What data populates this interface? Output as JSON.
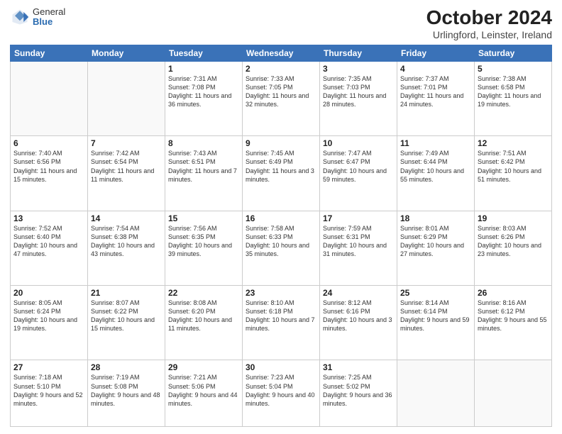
{
  "logo": {
    "general": "General",
    "blue": "Blue"
  },
  "header": {
    "title": "October 2024",
    "subtitle": "Urlingford, Leinster, Ireland"
  },
  "days_of_week": [
    "Sunday",
    "Monday",
    "Tuesday",
    "Wednesday",
    "Thursday",
    "Friday",
    "Saturday"
  ],
  "weeks": [
    [
      {
        "day": "",
        "detail": ""
      },
      {
        "day": "",
        "detail": ""
      },
      {
        "day": "1",
        "detail": "Sunrise: 7:31 AM\nSunset: 7:08 PM\nDaylight: 11 hours\nand 36 minutes."
      },
      {
        "day": "2",
        "detail": "Sunrise: 7:33 AM\nSunset: 7:05 PM\nDaylight: 11 hours\nand 32 minutes."
      },
      {
        "day": "3",
        "detail": "Sunrise: 7:35 AM\nSunset: 7:03 PM\nDaylight: 11 hours\nand 28 minutes."
      },
      {
        "day": "4",
        "detail": "Sunrise: 7:37 AM\nSunset: 7:01 PM\nDaylight: 11 hours\nand 24 minutes."
      },
      {
        "day": "5",
        "detail": "Sunrise: 7:38 AM\nSunset: 6:58 PM\nDaylight: 11 hours\nand 19 minutes."
      }
    ],
    [
      {
        "day": "6",
        "detail": "Sunrise: 7:40 AM\nSunset: 6:56 PM\nDaylight: 11 hours\nand 15 minutes."
      },
      {
        "day": "7",
        "detail": "Sunrise: 7:42 AM\nSunset: 6:54 PM\nDaylight: 11 hours\nand 11 minutes."
      },
      {
        "day": "8",
        "detail": "Sunrise: 7:43 AM\nSunset: 6:51 PM\nDaylight: 11 hours\nand 7 minutes."
      },
      {
        "day": "9",
        "detail": "Sunrise: 7:45 AM\nSunset: 6:49 PM\nDaylight: 11 hours\nand 3 minutes."
      },
      {
        "day": "10",
        "detail": "Sunrise: 7:47 AM\nSunset: 6:47 PM\nDaylight: 10 hours\nand 59 minutes."
      },
      {
        "day": "11",
        "detail": "Sunrise: 7:49 AM\nSunset: 6:44 PM\nDaylight: 10 hours\nand 55 minutes."
      },
      {
        "day": "12",
        "detail": "Sunrise: 7:51 AM\nSunset: 6:42 PM\nDaylight: 10 hours\nand 51 minutes."
      }
    ],
    [
      {
        "day": "13",
        "detail": "Sunrise: 7:52 AM\nSunset: 6:40 PM\nDaylight: 10 hours\nand 47 minutes."
      },
      {
        "day": "14",
        "detail": "Sunrise: 7:54 AM\nSunset: 6:38 PM\nDaylight: 10 hours\nand 43 minutes."
      },
      {
        "day": "15",
        "detail": "Sunrise: 7:56 AM\nSunset: 6:35 PM\nDaylight: 10 hours\nand 39 minutes."
      },
      {
        "day": "16",
        "detail": "Sunrise: 7:58 AM\nSunset: 6:33 PM\nDaylight: 10 hours\nand 35 minutes."
      },
      {
        "day": "17",
        "detail": "Sunrise: 7:59 AM\nSunset: 6:31 PM\nDaylight: 10 hours\nand 31 minutes."
      },
      {
        "day": "18",
        "detail": "Sunrise: 8:01 AM\nSunset: 6:29 PM\nDaylight: 10 hours\nand 27 minutes."
      },
      {
        "day": "19",
        "detail": "Sunrise: 8:03 AM\nSunset: 6:26 PM\nDaylight: 10 hours\nand 23 minutes."
      }
    ],
    [
      {
        "day": "20",
        "detail": "Sunrise: 8:05 AM\nSunset: 6:24 PM\nDaylight: 10 hours\nand 19 minutes."
      },
      {
        "day": "21",
        "detail": "Sunrise: 8:07 AM\nSunset: 6:22 PM\nDaylight: 10 hours\nand 15 minutes."
      },
      {
        "day": "22",
        "detail": "Sunrise: 8:08 AM\nSunset: 6:20 PM\nDaylight: 10 hours\nand 11 minutes."
      },
      {
        "day": "23",
        "detail": "Sunrise: 8:10 AM\nSunset: 6:18 PM\nDaylight: 10 hours\nand 7 minutes."
      },
      {
        "day": "24",
        "detail": "Sunrise: 8:12 AM\nSunset: 6:16 PM\nDaylight: 10 hours\nand 3 minutes."
      },
      {
        "day": "25",
        "detail": "Sunrise: 8:14 AM\nSunset: 6:14 PM\nDaylight: 9 hours\nand 59 minutes."
      },
      {
        "day": "26",
        "detail": "Sunrise: 8:16 AM\nSunset: 6:12 PM\nDaylight: 9 hours\nand 55 minutes."
      }
    ],
    [
      {
        "day": "27",
        "detail": "Sunrise: 7:18 AM\nSunset: 5:10 PM\nDaylight: 9 hours\nand 52 minutes."
      },
      {
        "day": "28",
        "detail": "Sunrise: 7:19 AM\nSunset: 5:08 PM\nDaylight: 9 hours\nand 48 minutes."
      },
      {
        "day": "29",
        "detail": "Sunrise: 7:21 AM\nSunset: 5:06 PM\nDaylight: 9 hours\nand 44 minutes."
      },
      {
        "day": "30",
        "detail": "Sunrise: 7:23 AM\nSunset: 5:04 PM\nDaylight: 9 hours\nand 40 minutes."
      },
      {
        "day": "31",
        "detail": "Sunrise: 7:25 AM\nSunset: 5:02 PM\nDaylight: 9 hours\nand 36 minutes."
      },
      {
        "day": "",
        "detail": ""
      },
      {
        "day": "",
        "detail": ""
      }
    ]
  ]
}
